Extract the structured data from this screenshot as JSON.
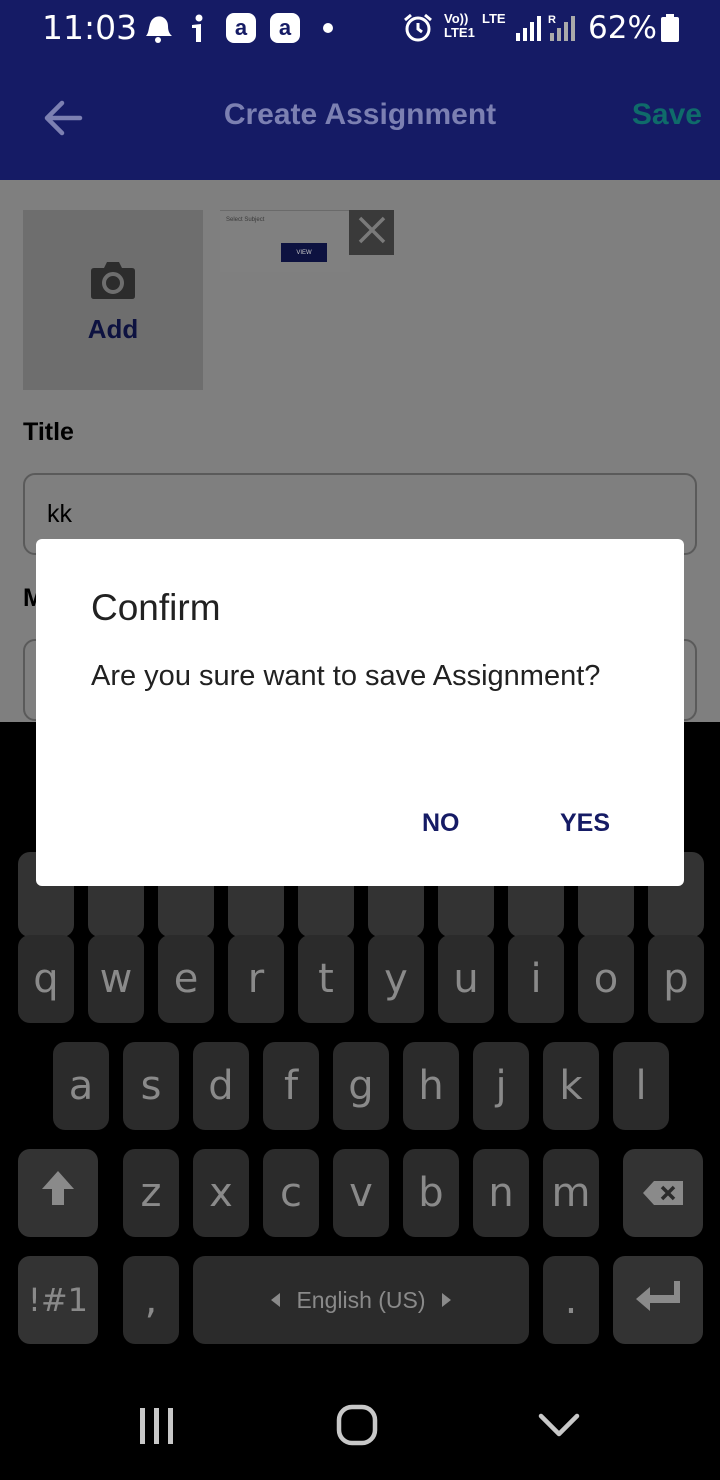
{
  "status_bar": {
    "time": "11:03",
    "network_label": "Vo)) LTE1",
    "lte_label": "LTE",
    "roaming_label": "R",
    "battery": "62%"
  },
  "app_bar": {
    "title": "Create Assignment",
    "save_label": "Save"
  },
  "attachments": {
    "add_label": "Add",
    "thumbnail": {
      "caption": "Select Subject",
      "view_label": "VIEW"
    }
  },
  "form": {
    "title_label": "Title",
    "title_value": "kk",
    "description_label_initial": "M"
  },
  "dialog": {
    "title": "Confirm",
    "message": "Are you sure want to save Assignment?",
    "no_label": "NO",
    "yes_label": "YES"
  },
  "keyboard": {
    "row_q": [
      "q",
      "w",
      "e",
      "r",
      "t",
      "y",
      "u",
      "i",
      "o",
      "p"
    ],
    "row_a": [
      "a",
      "s",
      "d",
      "f",
      "g",
      "h",
      "j",
      "k",
      "l"
    ],
    "row_z": [
      "z",
      "x",
      "c",
      "v",
      "b",
      "n",
      "m"
    ],
    "symbols_label": "!#1",
    "comma": ",",
    "space_label": "English (US)",
    "period": "."
  },
  "colors": {
    "app_bar": "#151b65",
    "save_action": "#0f6b6a",
    "dialog_button": "#151b65",
    "scrim": "#7f7f7f"
  }
}
